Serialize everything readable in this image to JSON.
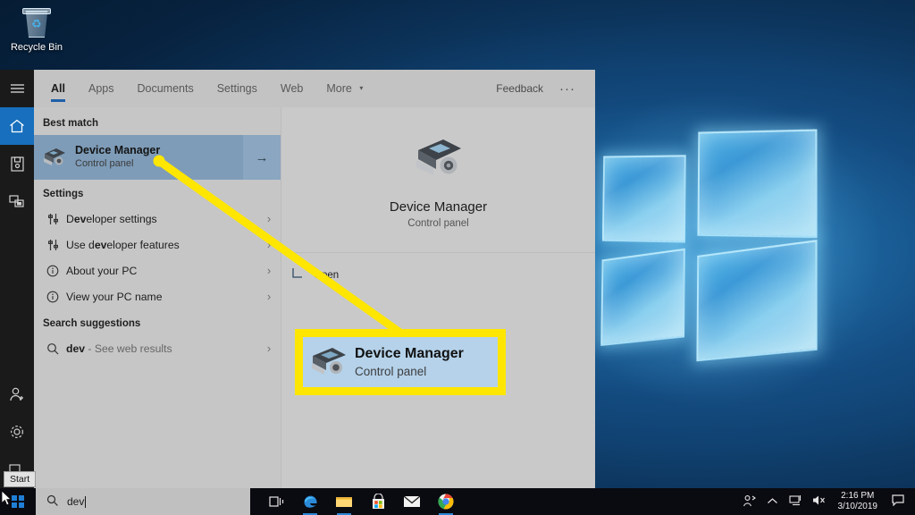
{
  "desktop": {
    "recycle_bin_label": "Recycle Bin",
    "recycle_bin_icon": "recycle-bin-icon",
    "wallpaper": "windows-10-hero-logo"
  },
  "start_rail": {
    "items": [
      {
        "icon": "hamburger-menu-icon",
        "name": "expand-menu"
      },
      {
        "icon": "home-icon",
        "name": "home",
        "active": true
      },
      {
        "icon": "documents-icon",
        "name": "documents"
      },
      {
        "icon": "pictures-icon",
        "name": "pictures"
      },
      {
        "icon": "account-icon",
        "name": "account"
      },
      {
        "icon": "settings-gear-icon",
        "name": "settings"
      },
      {
        "icon": "power-icon",
        "name": "power"
      }
    ]
  },
  "search_panel": {
    "tabs": [
      {
        "label": "All",
        "active": true
      },
      {
        "label": "Apps",
        "active": false
      },
      {
        "label": "Documents",
        "active": false
      },
      {
        "label": "Settings",
        "active": false
      },
      {
        "label": "Web",
        "active": false
      },
      {
        "label": "More",
        "active": false,
        "caret": "▾"
      }
    ],
    "feedback_label": "Feedback",
    "overflow_label": "···",
    "best_match": {
      "header": "Best match",
      "title": "Device Manager",
      "subtitle": "Control panel",
      "icon": "device-manager-icon",
      "arrow": "→"
    },
    "settings_group": {
      "header": "Settings",
      "items": [
        {
          "label_pre": "D",
          "label_bold": "ev",
          "label_post": "eloper settings",
          "icon": "sliders-icon"
        },
        {
          "label_pre": "Use d",
          "label_bold": "ev",
          "label_post": "eloper features",
          "icon": "sliders-icon"
        },
        {
          "label_pre": "About your PC",
          "label_bold": "",
          "label_post": "",
          "icon": "info-circle-icon"
        },
        {
          "label_pre": "View your PC name",
          "label_bold": "",
          "label_post": "",
          "icon": "info-circle-icon"
        }
      ],
      "chevron": "›"
    },
    "suggestions_group": {
      "header": "Search suggestions",
      "items": [
        {
          "query": "dev",
          "suffix": " - See web results",
          "icon": "search-icon"
        }
      ],
      "chevron": "›"
    },
    "preview": {
      "icon": "device-manager-icon",
      "title": "Device Manager",
      "subtitle": "Control panel",
      "action_label": "Open",
      "action_icon": "open-app-icon"
    }
  },
  "callout": {
    "title": "Device Manager",
    "subtitle": "Control panel",
    "icon": "device-manager-icon",
    "highlight_color": "#ffe600",
    "fill_color": "#b5d2ea"
  },
  "taskbar": {
    "start_icon": "windows-logo-icon",
    "start_tooltip": "Start",
    "search": {
      "value": "dev",
      "icon": "search-icon"
    },
    "apps": [
      {
        "name": "task-view",
        "icon": "task-view-icon"
      },
      {
        "name": "microsoft-edge",
        "icon": "edge-icon",
        "running": true
      },
      {
        "name": "file-explorer",
        "icon": "folder-icon",
        "running": true
      },
      {
        "name": "microsoft-store",
        "icon": "store-icon"
      },
      {
        "name": "mail",
        "icon": "mail-icon"
      },
      {
        "name": "google-chrome",
        "icon": "chrome-icon",
        "running": true
      }
    ],
    "tray": [
      {
        "name": "people",
        "icon": "person-share-icon",
        "glyph": "⚘"
      },
      {
        "name": "show-hidden-icons",
        "icon": "chevron-up-icon",
        "glyph": "∧"
      },
      {
        "name": "network",
        "icon": "network-monitor-icon",
        "glyph": "⎙"
      },
      {
        "name": "volume-muted",
        "icon": "speaker-mute-icon",
        "glyph": "🔇"
      }
    ],
    "clock": {
      "time": "2:16 PM",
      "date": "3/10/2019"
    },
    "action_center_icon": "action-center-icon"
  }
}
